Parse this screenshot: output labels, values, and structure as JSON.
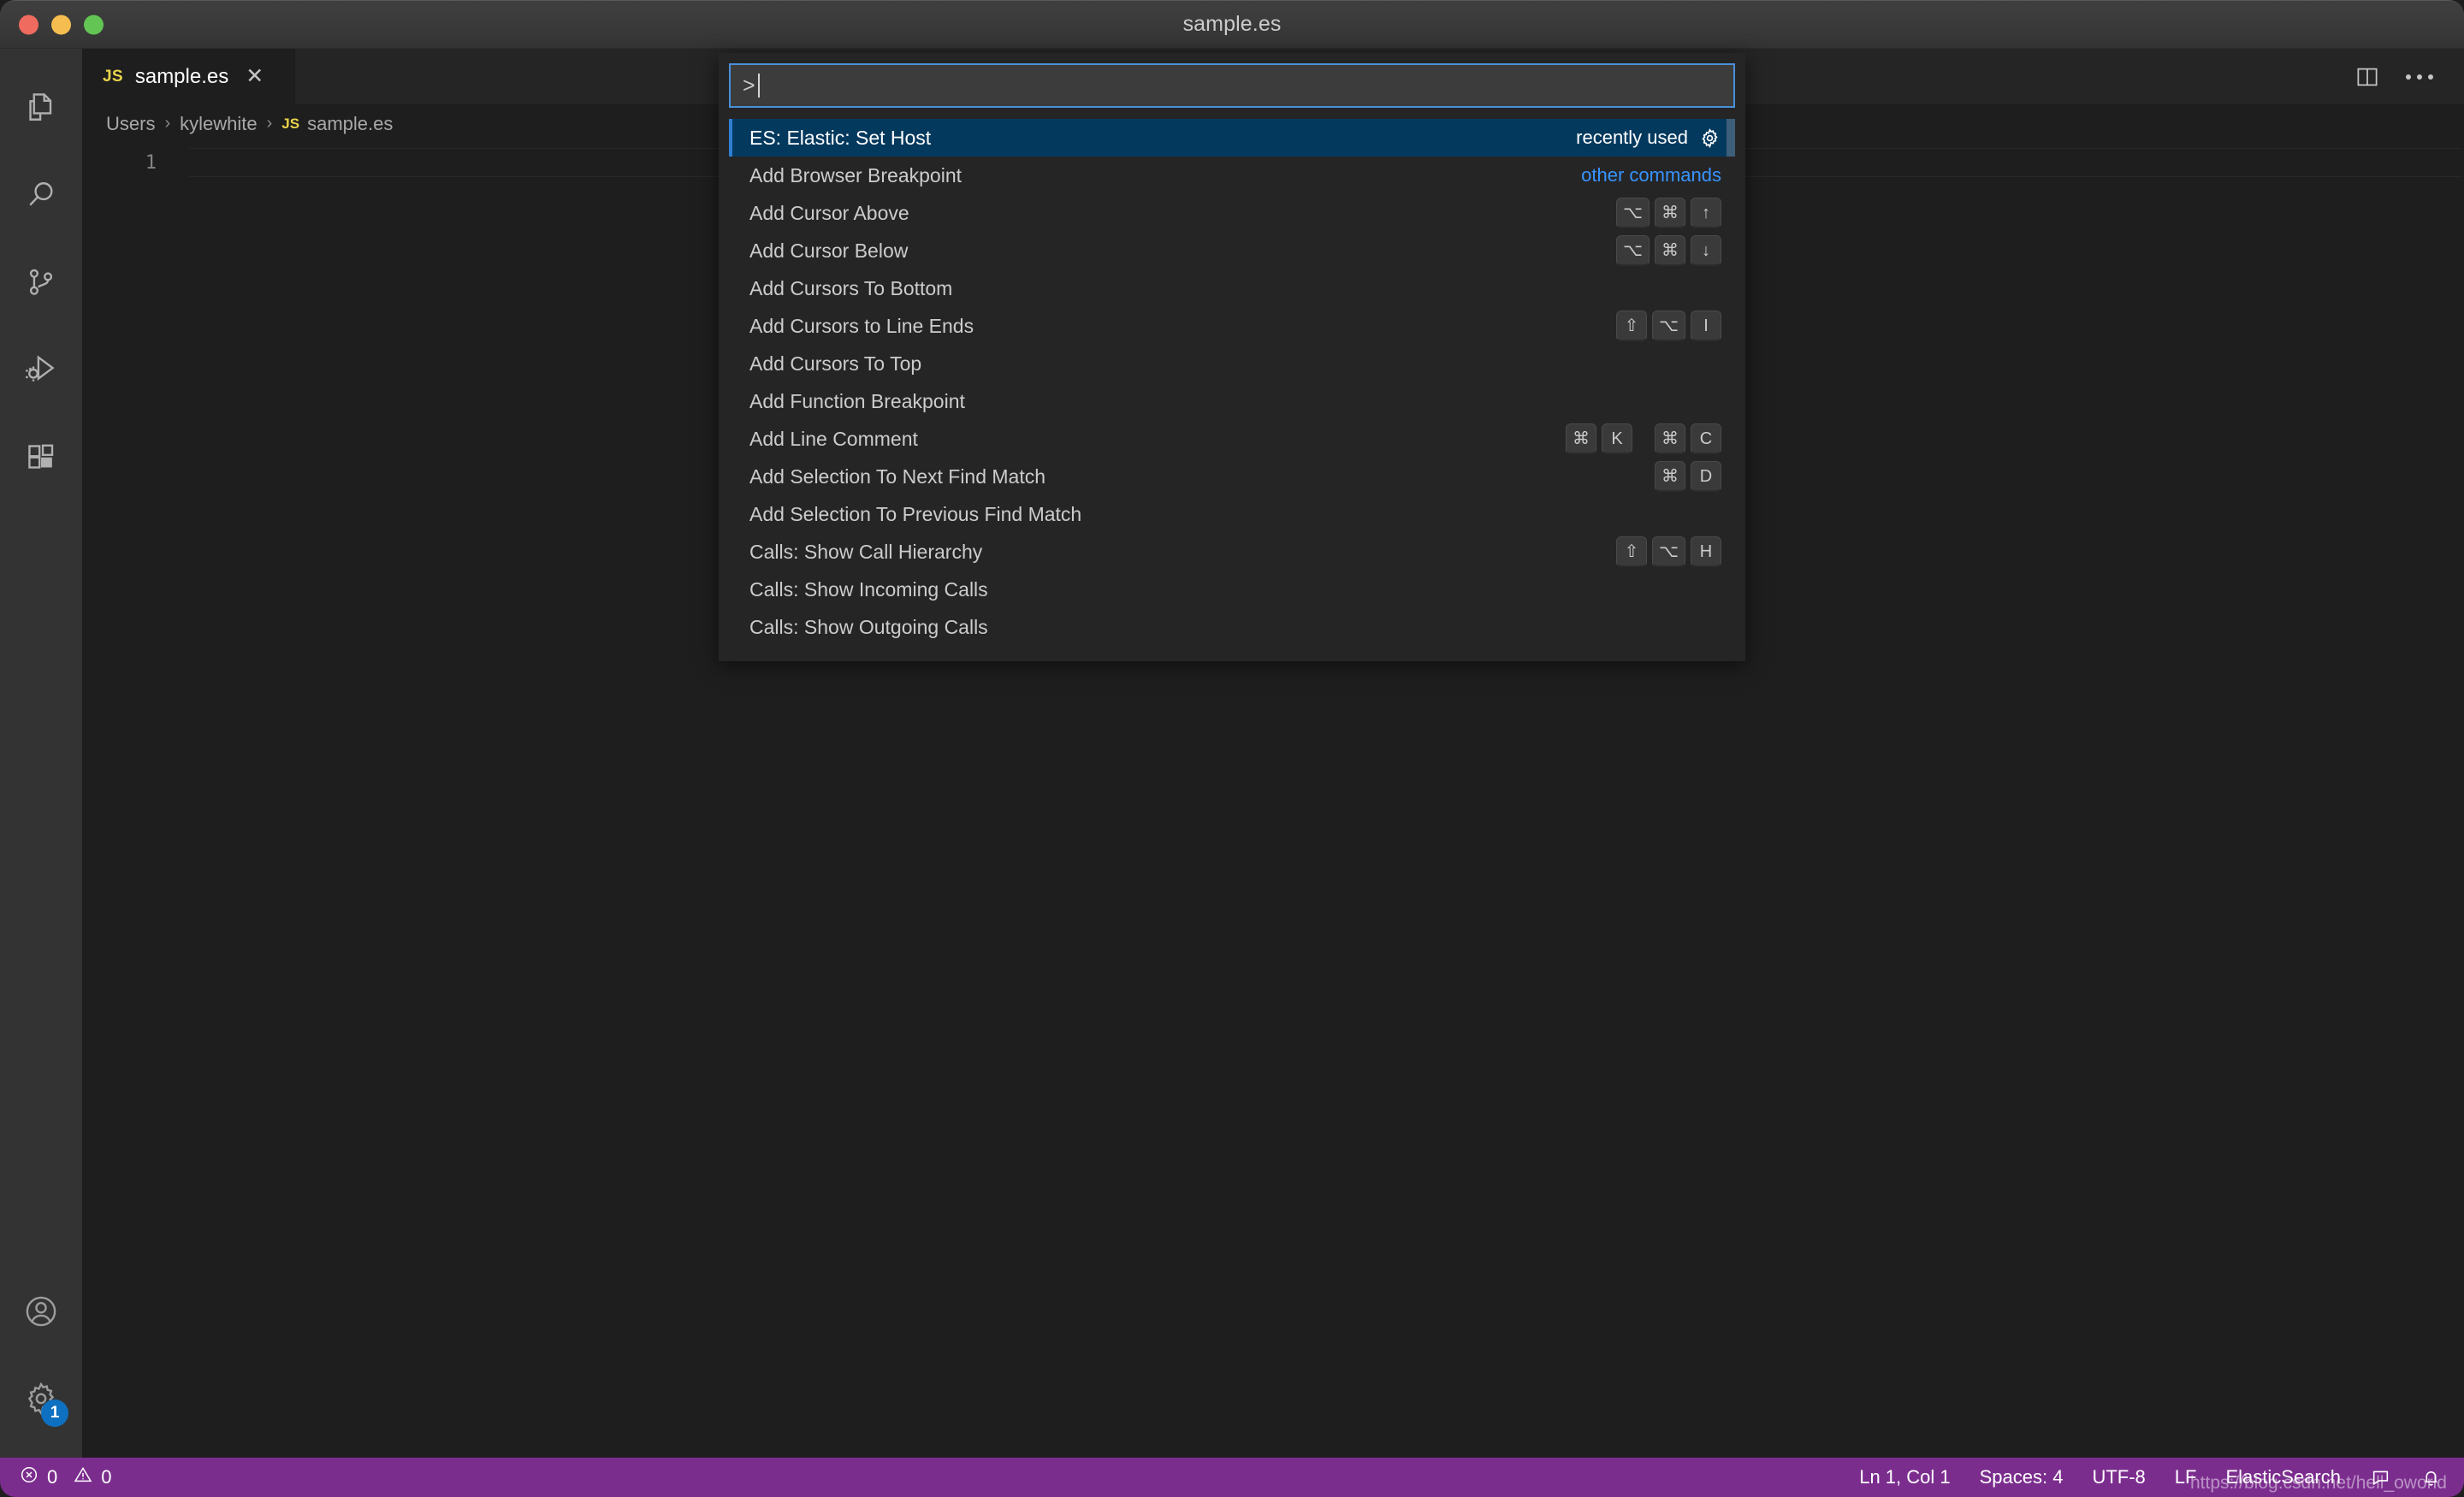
{
  "window": {
    "title": "sample.es",
    "traffic_lights": [
      "close-red",
      "minimize-yellow",
      "zoom-green"
    ]
  },
  "activitybar": {
    "items": [
      {
        "name": "explorer",
        "icon": "files-icon"
      },
      {
        "name": "search",
        "icon": "search-icon"
      },
      {
        "name": "source-control",
        "icon": "source-control-icon"
      },
      {
        "name": "run-and-debug",
        "icon": "run-debug-icon"
      },
      {
        "name": "extensions",
        "icon": "extensions-icon"
      }
    ],
    "bottom": [
      {
        "name": "accounts",
        "icon": "account-icon",
        "badge": ""
      },
      {
        "name": "manage",
        "icon": "gear-icon",
        "badge": "1"
      }
    ]
  },
  "tab": {
    "file_type": "JS",
    "label": "sample.es",
    "close_glyph": "✕"
  },
  "editor_actions": {
    "split_editor": "split-editor-icon",
    "more_actions": "more-actions-icon"
  },
  "breadcrumbs": {
    "items": [
      "Users",
      "kylewhite",
      "sample.es"
    ],
    "separator": "›",
    "file_type": "JS"
  },
  "editor": {
    "line_numbers": [
      "1"
    ],
    "lines": [
      ""
    ]
  },
  "quick_input": {
    "prompt": ">",
    "value": "",
    "placeholder": "",
    "group_recently_used": "recently used",
    "group_other_commands": "other commands",
    "gear_icon": "gear-icon",
    "items": [
      {
        "label": "ES: Elastic: Set Host",
        "selected": true,
        "group": "recently used",
        "group_style": "white",
        "has_gear": true,
        "keys": []
      },
      {
        "label": "Add Browser Breakpoint",
        "selected": false,
        "group": "other commands",
        "group_style": "blue",
        "has_gear": false,
        "keys": []
      },
      {
        "label": "Add Cursor Above",
        "selected": false,
        "group": "",
        "group_style": "",
        "has_gear": false,
        "keys": [
          "⌥",
          "⌘",
          "↑"
        ]
      },
      {
        "label": "Add Cursor Below",
        "selected": false,
        "group": "",
        "group_style": "",
        "has_gear": false,
        "keys": [
          "⌥",
          "⌘",
          "↓"
        ]
      },
      {
        "label": "Add Cursors To Bottom",
        "selected": false,
        "group": "",
        "group_style": "",
        "has_gear": false,
        "keys": []
      },
      {
        "label": "Add Cursors to Line Ends",
        "selected": false,
        "group": "",
        "group_style": "",
        "has_gear": false,
        "keys": [
          "⇧",
          "⌥",
          "I"
        ]
      },
      {
        "label": "Add Cursors To Top",
        "selected": false,
        "group": "",
        "group_style": "",
        "has_gear": false,
        "keys": []
      },
      {
        "label": "Add Function Breakpoint",
        "selected": false,
        "group": "",
        "group_style": "",
        "has_gear": false,
        "keys": []
      },
      {
        "label": "Add Line Comment",
        "selected": false,
        "group": "",
        "group_style": "",
        "has_gear": false,
        "keys": [
          "⌘",
          "K",
          "gap",
          "⌘",
          "C"
        ]
      },
      {
        "label": "Add Selection To Next Find Match",
        "selected": false,
        "group": "",
        "group_style": "",
        "has_gear": false,
        "keys": [
          "⌘",
          "D"
        ]
      },
      {
        "label": "Add Selection To Previous Find Match",
        "selected": false,
        "group": "",
        "group_style": "",
        "has_gear": false,
        "keys": []
      },
      {
        "label": "Calls: Show Call Hierarchy",
        "selected": false,
        "group": "",
        "group_style": "",
        "has_gear": false,
        "keys": [
          "⇧",
          "⌥",
          "H"
        ]
      },
      {
        "label": "Calls: Show Incoming Calls",
        "selected": false,
        "group": "",
        "group_style": "",
        "has_gear": false,
        "keys": []
      },
      {
        "label": "Calls: Show Outgoing Calls",
        "selected": false,
        "group": "",
        "group_style": "",
        "has_gear": false,
        "keys": []
      }
    ]
  },
  "statusbar": {
    "errors": "0",
    "warnings": "0",
    "cursor_position": "Ln 1, Col 1",
    "indentation": "Spaces: 4",
    "encoding": "UTF-8",
    "eol": "LF",
    "language_mode": "ElasticSearch",
    "feedback_icon": "feedback-icon",
    "bell_icon": "bell-icon",
    "watermark": "https://blog.csdn.net/hell_oworld"
  },
  "colors": {
    "accent_blue": "#0e70c0",
    "selection_blue": "#04395e",
    "statusbar_purple": "#7b2d8e",
    "js_yellow": "#e9d44b",
    "link_blue": "#3794ff"
  }
}
